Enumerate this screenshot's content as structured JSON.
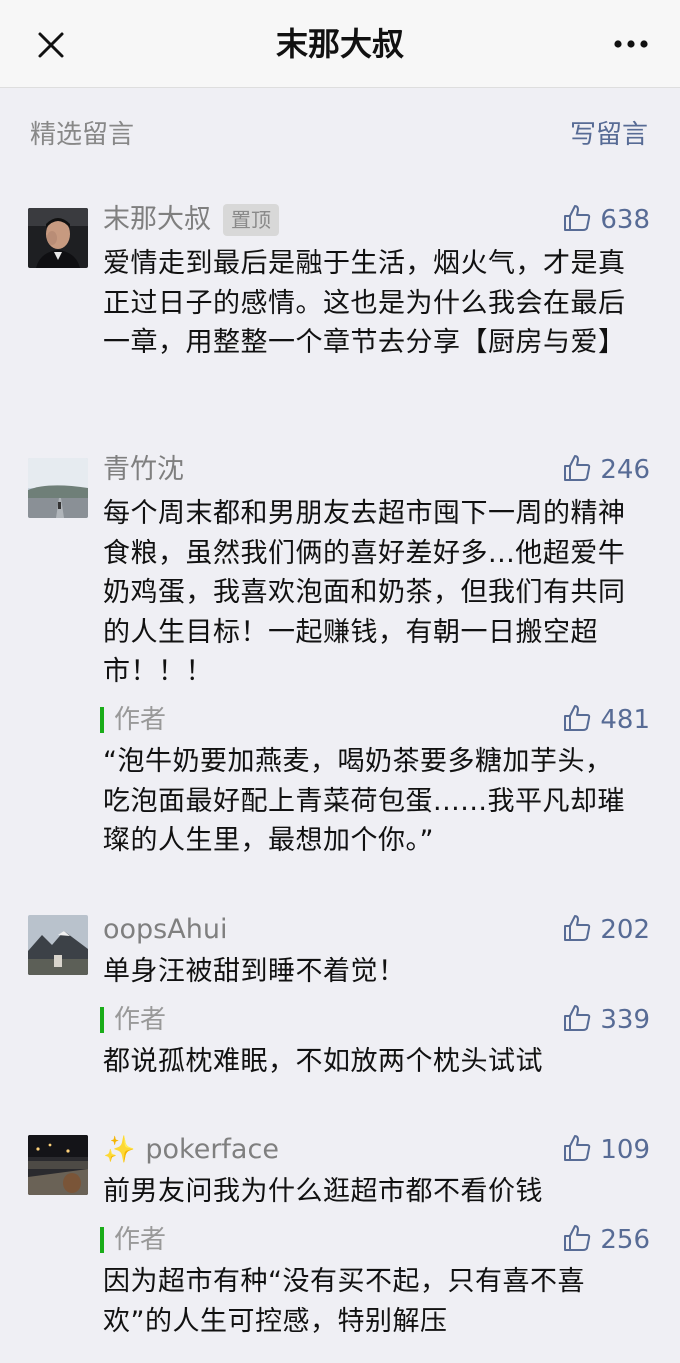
{
  "header": {
    "title": "末那大叔"
  },
  "section": {
    "title": "精选留言",
    "write_label": "写留言"
  },
  "colors": {
    "accent": "#576b95",
    "author_bar": "#1aad19",
    "background": "#efeff4"
  },
  "comments": [
    {
      "nickname": "末那大叔",
      "badge": "置顶",
      "likes": "638",
      "text": "爱情走到最后是融于生活，烟火气，才是真正过日子的感情。这也是为什么我会在最后一章，用整整一个章节去分享【厨房与爱】"
    },
    {
      "nickname": "青竹沈",
      "likes": "246",
      "text": "每个周末都和男朋友去超市囤下一周的精神食粮，虽然我们俩的喜好差好多...他超爱牛奶鸡蛋，我喜欢泡面和奶茶，但我们有共同的人生目标！一起赚钱，有朝一日搬空超市！！！",
      "reply": {
        "label": "作者",
        "likes": "481",
        "text": "“泡牛奶要加燕麦，喝奶茶要多糖加芋头，吃泡面最好配上青菜荷包蛋......我平凡却璀璨的人生里，最想加个你。”"
      }
    },
    {
      "nickname": "oopsAhui",
      "likes": "202",
      "text": "单身汪被甜到睡不着觉！",
      "reply": {
        "label": "作者",
        "likes": "339",
        "text": "都说孤枕难眠，不如放两个枕头试试"
      }
    },
    {
      "nickname": "pokerface",
      "nickname_prefix": "✨",
      "likes": "109",
      "text": "前男友问我为什么逛超市都不看价钱",
      "reply": {
        "label": "作者",
        "likes": "256",
        "text": "因为超市有种“没有买不起，只有喜不喜欢”的人生可控感，特别解压"
      }
    }
  ]
}
